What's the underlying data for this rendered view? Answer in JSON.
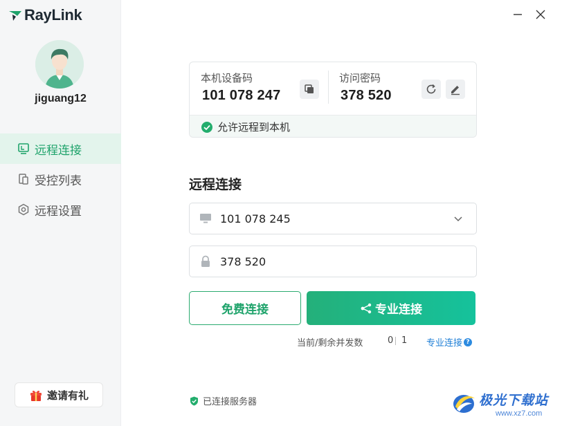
{
  "app": {
    "name": "RayLink",
    "username": "jiguang12"
  },
  "sidebar": {
    "items": [
      {
        "label": "远程连接",
        "icon": "remote-desktop-icon",
        "active": true
      },
      {
        "label": "受控列表",
        "icon": "device-list-icon",
        "active": false
      },
      {
        "label": "远程设置",
        "icon": "settings-hex-icon",
        "active": false
      }
    ],
    "invite_label": "邀请有礼"
  },
  "device": {
    "code_label": "本机设备码",
    "code_value": "101 078 247",
    "password_label": "访问密码",
    "password_value": "378 520",
    "allow_remote_label": "允许远程到本机"
  },
  "connect": {
    "title": "远程连接",
    "device_input_value": "101 078 245",
    "password_input_value": "378 520",
    "free_button_label": "免费连接",
    "pro_button_label": "专业连接",
    "concurrent_label": "当前/剩余并发数",
    "concurrent_current": "0",
    "concurrent_remaining": "1",
    "pro_link_label": "专业连接",
    "help_glyph": "?"
  },
  "status": {
    "server_label": "已连接服务器"
  },
  "watermark": {
    "brand": "极光下载站",
    "url": "www.xz7.com"
  },
  "colors": {
    "accent": "#1fa36b",
    "link": "#1f7fd6",
    "sidebar_bg": "#f5f6f7"
  }
}
